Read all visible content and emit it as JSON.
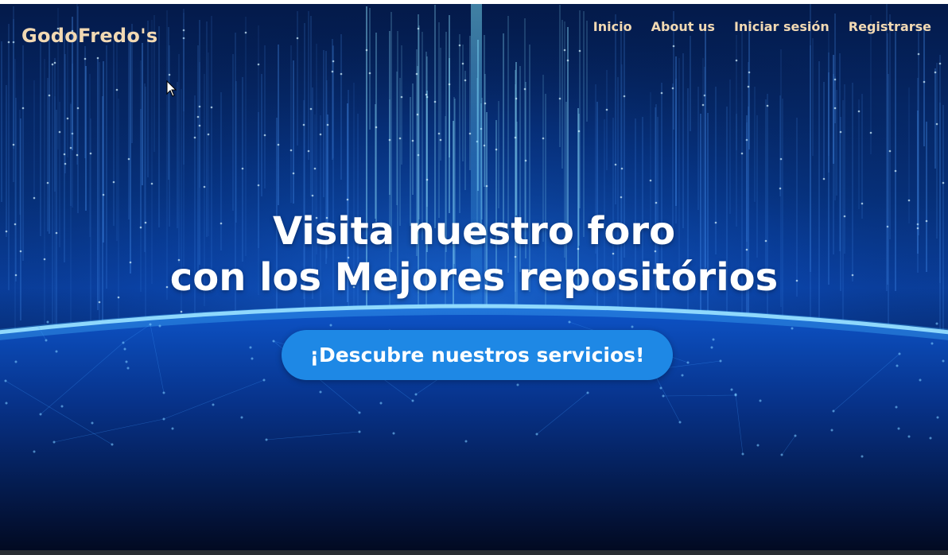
{
  "brand": {
    "name": "GodoFredo's"
  },
  "nav": {
    "items": [
      {
        "label": "Inicio"
      },
      {
        "label": "About us"
      },
      {
        "label": "Iniciar sesión"
      },
      {
        "label": "Registrarse"
      }
    ]
  },
  "hero": {
    "headline_line1": "Visita nuestro foro",
    "headline_line2": "con los Mejores repositórios",
    "cta_label": "¡Descubre nuestros servicios!",
    "background": "digital-rain-globe-image"
  },
  "colors": {
    "nav_text": "#f2d9b3",
    "cta_background": "#1e88e5",
    "headline_text": "#ffffff"
  }
}
